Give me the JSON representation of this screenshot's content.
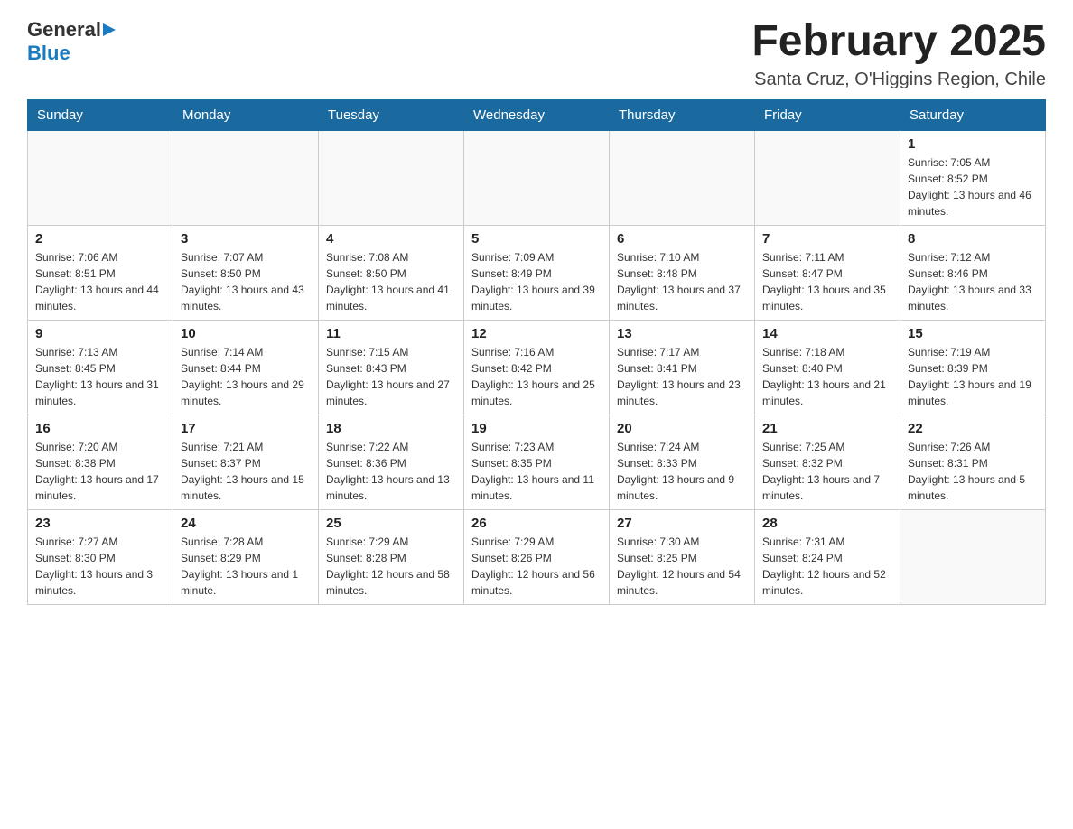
{
  "header": {
    "logo_general": "General",
    "logo_blue": "Blue",
    "title": "February 2025",
    "subtitle": "Santa Cruz, O'Higgins Region, Chile"
  },
  "days_of_week": [
    "Sunday",
    "Monday",
    "Tuesday",
    "Wednesday",
    "Thursday",
    "Friday",
    "Saturday"
  ],
  "weeks": [
    [
      {
        "day": "",
        "sunrise": "",
        "sunset": "",
        "daylight": ""
      },
      {
        "day": "",
        "sunrise": "",
        "sunset": "",
        "daylight": ""
      },
      {
        "day": "",
        "sunrise": "",
        "sunset": "",
        "daylight": ""
      },
      {
        "day": "",
        "sunrise": "",
        "sunset": "",
        "daylight": ""
      },
      {
        "day": "",
        "sunrise": "",
        "sunset": "",
        "daylight": ""
      },
      {
        "day": "",
        "sunrise": "",
        "sunset": "",
        "daylight": ""
      },
      {
        "day": "1",
        "sunrise": "Sunrise: 7:05 AM",
        "sunset": "Sunset: 8:52 PM",
        "daylight": "Daylight: 13 hours and 46 minutes."
      }
    ],
    [
      {
        "day": "2",
        "sunrise": "Sunrise: 7:06 AM",
        "sunset": "Sunset: 8:51 PM",
        "daylight": "Daylight: 13 hours and 44 minutes."
      },
      {
        "day": "3",
        "sunrise": "Sunrise: 7:07 AM",
        "sunset": "Sunset: 8:50 PM",
        "daylight": "Daylight: 13 hours and 43 minutes."
      },
      {
        "day": "4",
        "sunrise": "Sunrise: 7:08 AM",
        "sunset": "Sunset: 8:50 PM",
        "daylight": "Daylight: 13 hours and 41 minutes."
      },
      {
        "day": "5",
        "sunrise": "Sunrise: 7:09 AM",
        "sunset": "Sunset: 8:49 PM",
        "daylight": "Daylight: 13 hours and 39 minutes."
      },
      {
        "day": "6",
        "sunrise": "Sunrise: 7:10 AM",
        "sunset": "Sunset: 8:48 PM",
        "daylight": "Daylight: 13 hours and 37 minutes."
      },
      {
        "day": "7",
        "sunrise": "Sunrise: 7:11 AM",
        "sunset": "Sunset: 8:47 PM",
        "daylight": "Daylight: 13 hours and 35 minutes."
      },
      {
        "day": "8",
        "sunrise": "Sunrise: 7:12 AM",
        "sunset": "Sunset: 8:46 PM",
        "daylight": "Daylight: 13 hours and 33 minutes."
      }
    ],
    [
      {
        "day": "9",
        "sunrise": "Sunrise: 7:13 AM",
        "sunset": "Sunset: 8:45 PM",
        "daylight": "Daylight: 13 hours and 31 minutes."
      },
      {
        "day": "10",
        "sunrise": "Sunrise: 7:14 AM",
        "sunset": "Sunset: 8:44 PM",
        "daylight": "Daylight: 13 hours and 29 minutes."
      },
      {
        "day": "11",
        "sunrise": "Sunrise: 7:15 AM",
        "sunset": "Sunset: 8:43 PM",
        "daylight": "Daylight: 13 hours and 27 minutes."
      },
      {
        "day": "12",
        "sunrise": "Sunrise: 7:16 AM",
        "sunset": "Sunset: 8:42 PM",
        "daylight": "Daylight: 13 hours and 25 minutes."
      },
      {
        "day": "13",
        "sunrise": "Sunrise: 7:17 AM",
        "sunset": "Sunset: 8:41 PM",
        "daylight": "Daylight: 13 hours and 23 minutes."
      },
      {
        "day": "14",
        "sunrise": "Sunrise: 7:18 AM",
        "sunset": "Sunset: 8:40 PM",
        "daylight": "Daylight: 13 hours and 21 minutes."
      },
      {
        "day": "15",
        "sunrise": "Sunrise: 7:19 AM",
        "sunset": "Sunset: 8:39 PM",
        "daylight": "Daylight: 13 hours and 19 minutes."
      }
    ],
    [
      {
        "day": "16",
        "sunrise": "Sunrise: 7:20 AM",
        "sunset": "Sunset: 8:38 PM",
        "daylight": "Daylight: 13 hours and 17 minutes."
      },
      {
        "day": "17",
        "sunrise": "Sunrise: 7:21 AM",
        "sunset": "Sunset: 8:37 PM",
        "daylight": "Daylight: 13 hours and 15 minutes."
      },
      {
        "day": "18",
        "sunrise": "Sunrise: 7:22 AM",
        "sunset": "Sunset: 8:36 PM",
        "daylight": "Daylight: 13 hours and 13 minutes."
      },
      {
        "day": "19",
        "sunrise": "Sunrise: 7:23 AM",
        "sunset": "Sunset: 8:35 PM",
        "daylight": "Daylight: 13 hours and 11 minutes."
      },
      {
        "day": "20",
        "sunrise": "Sunrise: 7:24 AM",
        "sunset": "Sunset: 8:33 PM",
        "daylight": "Daylight: 13 hours and 9 minutes."
      },
      {
        "day": "21",
        "sunrise": "Sunrise: 7:25 AM",
        "sunset": "Sunset: 8:32 PM",
        "daylight": "Daylight: 13 hours and 7 minutes."
      },
      {
        "day": "22",
        "sunrise": "Sunrise: 7:26 AM",
        "sunset": "Sunset: 8:31 PM",
        "daylight": "Daylight: 13 hours and 5 minutes."
      }
    ],
    [
      {
        "day": "23",
        "sunrise": "Sunrise: 7:27 AM",
        "sunset": "Sunset: 8:30 PM",
        "daylight": "Daylight: 13 hours and 3 minutes."
      },
      {
        "day": "24",
        "sunrise": "Sunrise: 7:28 AM",
        "sunset": "Sunset: 8:29 PM",
        "daylight": "Daylight: 13 hours and 1 minute."
      },
      {
        "day": "25",
        "sunrise": "Sunrise: 7:29 AM",
        "sunset": "Sunset: 8:28 PM",
        "daylight": "Daylight: 12 hours and 58 minutes."
      },
      {
        "day": "26",
        "sunrise": "Sunrise: 7:29 AM",
        "sunset": "Sunset: 8:26 PM",
        "daylight": "Daylight: 12 hours and 56 minutes."
      },
      {
        "day": "27",
        "sunrise": "Sunrise: 7:30 AM",
        "sunset": "Sunset: 8:25 PM",
        "daylight": "Daylight: 12 hours and 54 minutes."
      },
      {
        "day": "28",
        "sunrise": "Sunrise: 7:31 AM",
        "sunset": "Sunset: 8:24 PM",
        "daylight": "Daylight: 12 hours and 52 minutes."
      },
      {
        "day": "",
        "sunrise": "",
        "sunset": "",
        "daylight": ""
      }
    ]
  ]
}
